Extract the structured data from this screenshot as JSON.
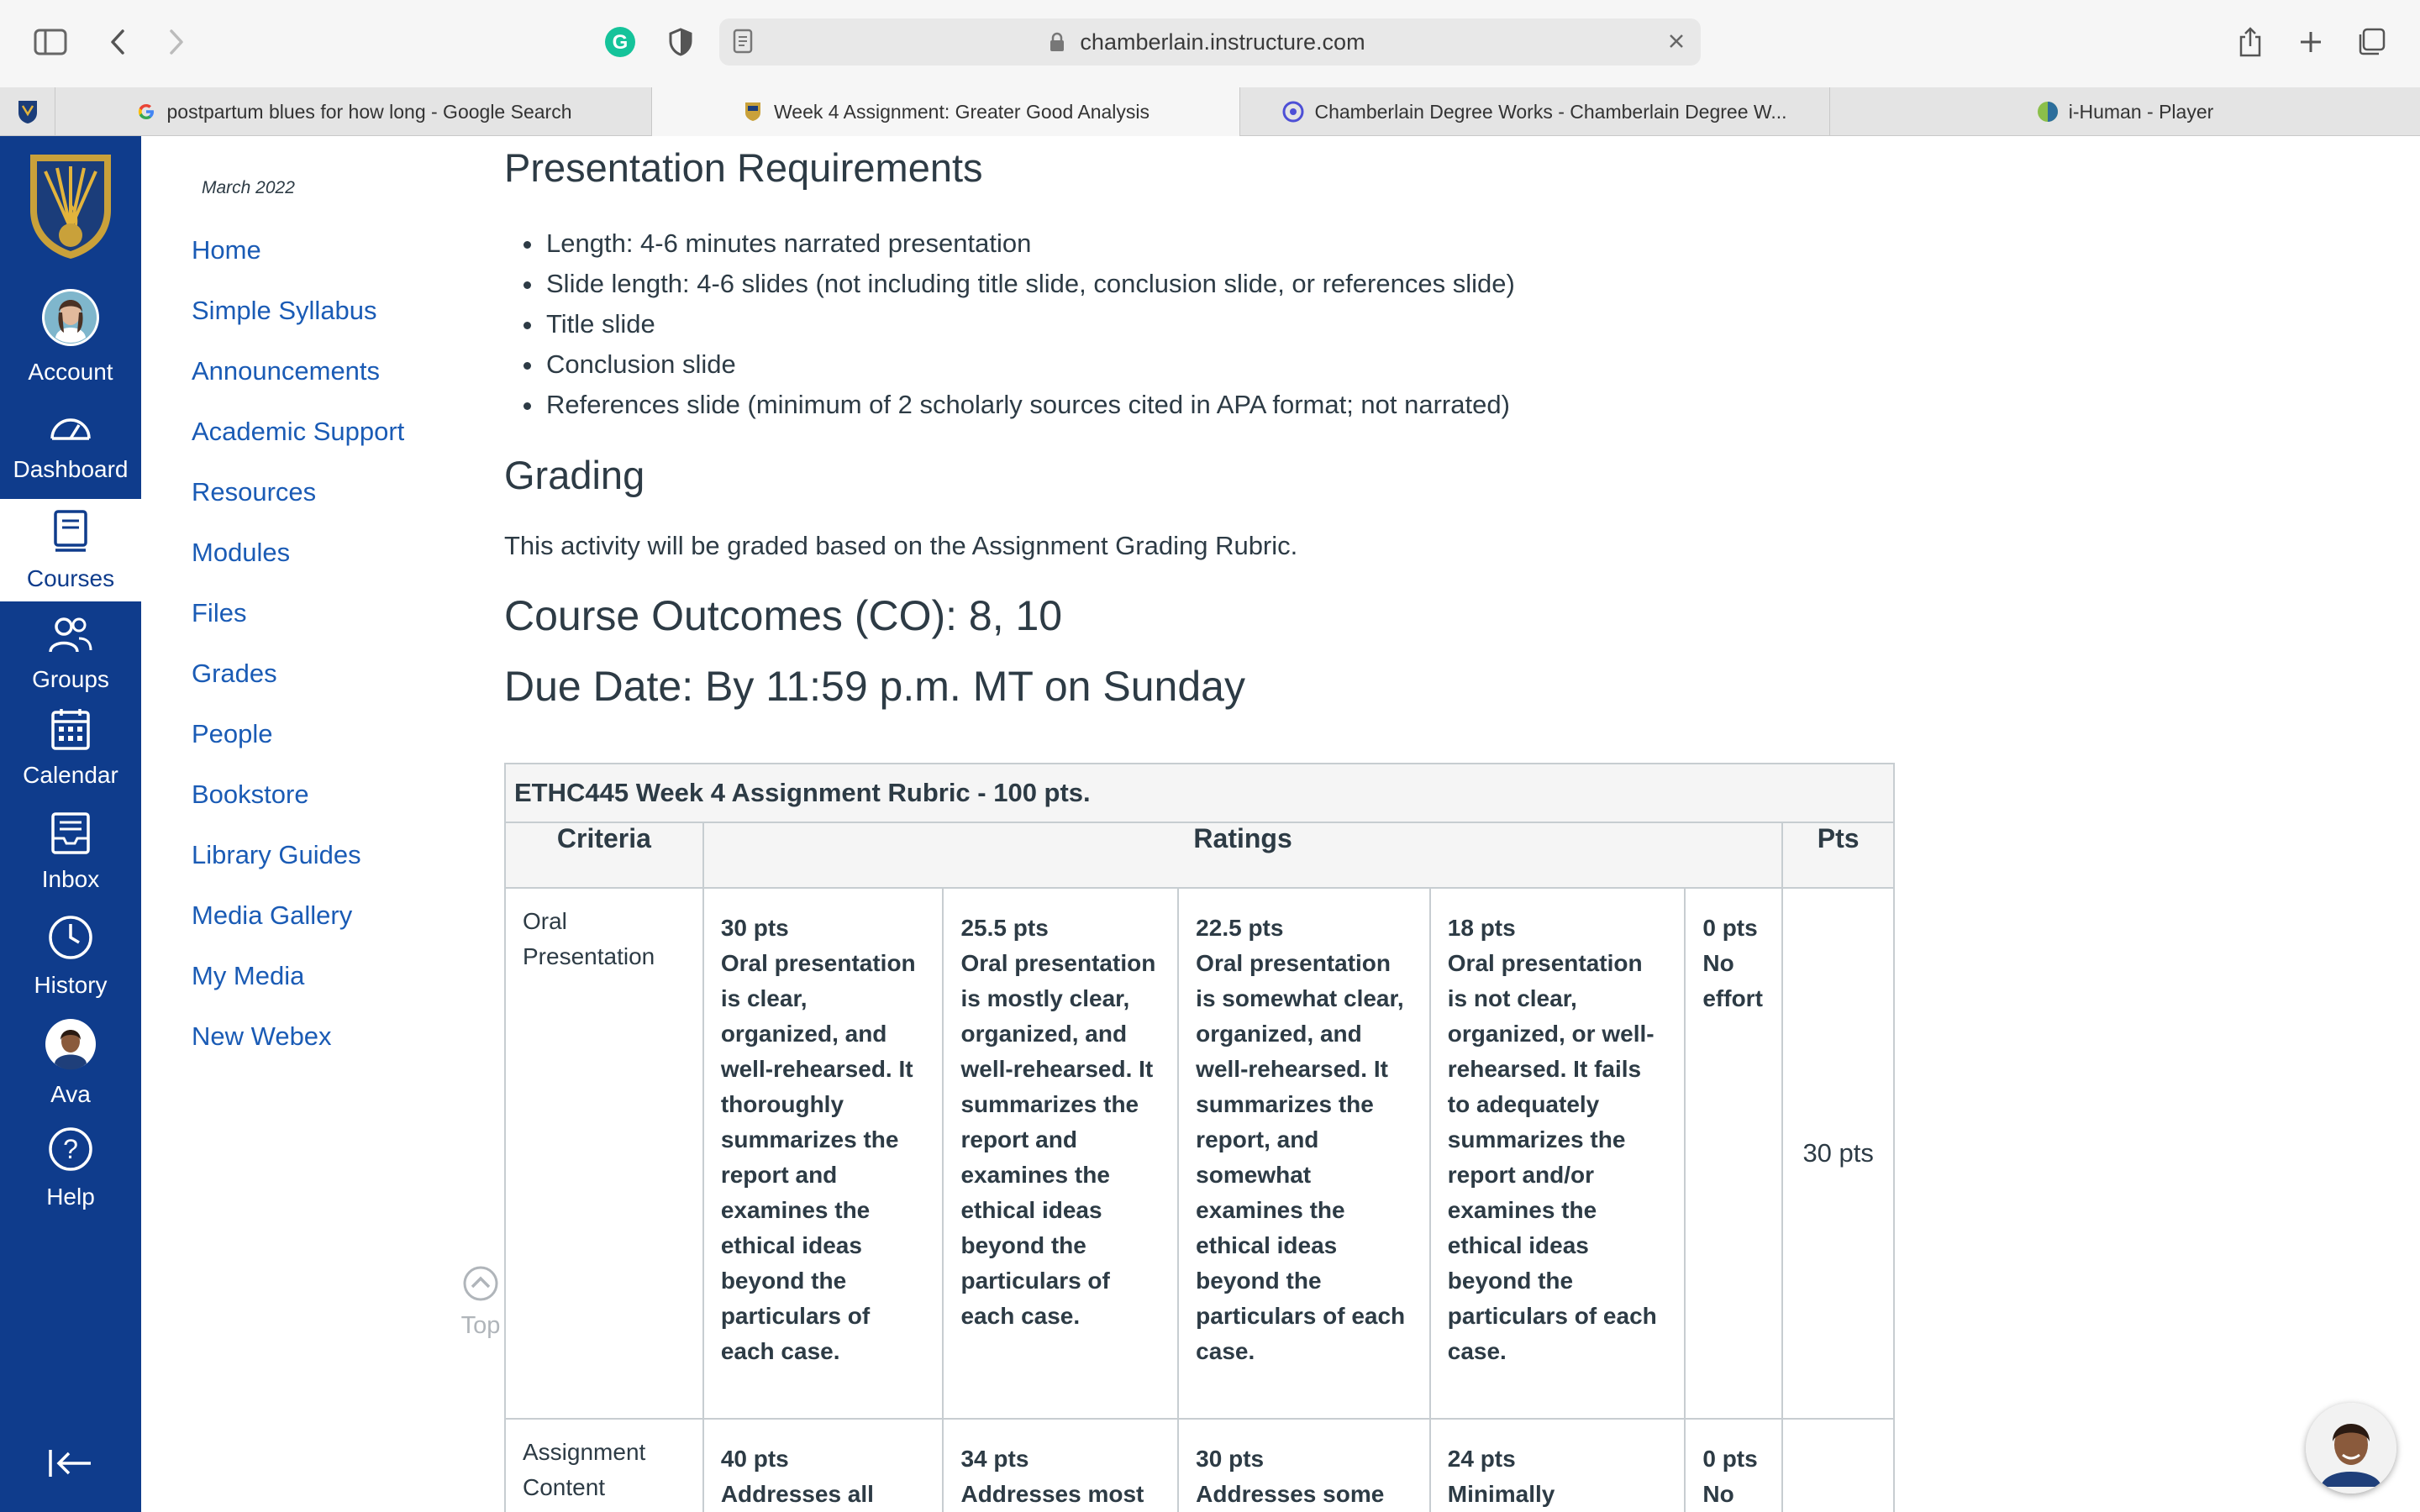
{
  "browser": {
    "url": "chamberlain.instructure.com",
    "tabs": [
      {
        "title": "postpartum blues for how long - Google Search",
        "icon": "google-icon"
      },
      {
        "title": "Week 4 Assignment: Greater Good Analysis",
        "icon": "chamberlain-icon"
      },
      {
        "title": "Chamberlain Degree Works - Chamberlain Degree W...",
        "icon": "degreeworks-icon"
      },
      {
        "title": "i-Human - Player",
        "icon": "ihuman-icon"
      }
    ]
  },
  "global_nav": {
    "account": "Account",
    "dashboard": "Dashboard",
    "courses": "Courses",
    "groups": "Groups",
    "calendar": "Calendar",
    "inbox": "Inbox",
    "history": "History",
    "ava": "Ava",
    "help": "Help"
  },
  "course_nav": {
    "term": "March 2022",
    "items": [
      "Home",
      "Simple Syllabus",
      "Announcements",
      "Academic Support",
      "Resources",
      "Modules",
      "Files",
      "Grades",
      "People",
      "Bookstore",
      "Library Guides",
      "Media Gallery",
      "My Media",
      "New Webex"
    ],
    "top_label": "Top"
  },
  "content": {
    "presentation_heading": "Presentation Requirements",
    "requirements": [
      "Length: 4-6 minutes narrated presentation",
      "Slide length: 4-6 slides (not including title slide, conclusion slide, or references slide)",
      "Title slide",
      "Conclusion slide",
      "References slide (minimum of 2 scholarly sources cited in APA format; not narrated)"
    ],
    "grading_heading": "Grading",
    "grading_text": "This activity will be graded based on the Assignment Grading Rubric.",
    "course_outcomes": "Course Outcomes (CO): 8, 10",
    "due_date": "Due Date: By 11:59 p.m. MT on Sunday"
  },
  "rubric": {
    "caption": "ETHC445 Week 4 Assignment Rubric - 100 pts.",
    "col_criteria": "Criteria",
    "col_ratings": "Ratings",
    "col_pts": "Pts",
    "row1": {
      "criterion_line1": "Oral",
      "criterion_line2": "Presentation",
      "r1_pts": "30 pts",
      "r1_desc": "Oral presentation is clear, organized, and well-rehearsed. It thoroughly summarizes the report and examines the ethical ideas beyond the particulars of each case.",
      "r2_pts": "25.5 pts",
      "r2_desc": "Oral presentation is mostly clear, organized, and well-rehearsed. It summarizes the report and examines the ethical ideas beyond the particulars of each case.",
      "r3_pts": "22.5 pts",
      "r3_desc": "Oral presentation is somewhat clear, organized, and well-rehearsed. It summarizes the report, and somewhat examines the ethical ideas beyond the particulars of each case.",
      "r4_pts": "18 pts",
      "r4_desc": "Oral presentation is not clear, organized, or well-rehearsed. It fails to adequately summarizes the report and/or examines the ethical ideas beyond the particulars of each case.",
      "r5_pts": "0 pts",
      "r5_desc": "No effort",
      "total": "30 pts"
    },
    "row2": {
      "criterion_line1": "Assignment",
      "criterion_line2": "Content",
      "r1_pts": "40 pts",
      "r1_desc": "Addresses all",
      "r2_pts": "34 pts",
      "r2_desc": "Addresses most",
      "r3_pts": "30 pts",
      "r3_desc": "Addresses some",
      "r4_pts": "24 pts",
      "r4_desc": "Minimally",
      "r5_pts": "0 pts",
      "r5_desc": "No"
    }
  },
  "colors": {
    "nav_blue": "#0f3c8c",
    "link_blue": "#1a5bb5",
    "text": "#2d3b45"
  }
}
